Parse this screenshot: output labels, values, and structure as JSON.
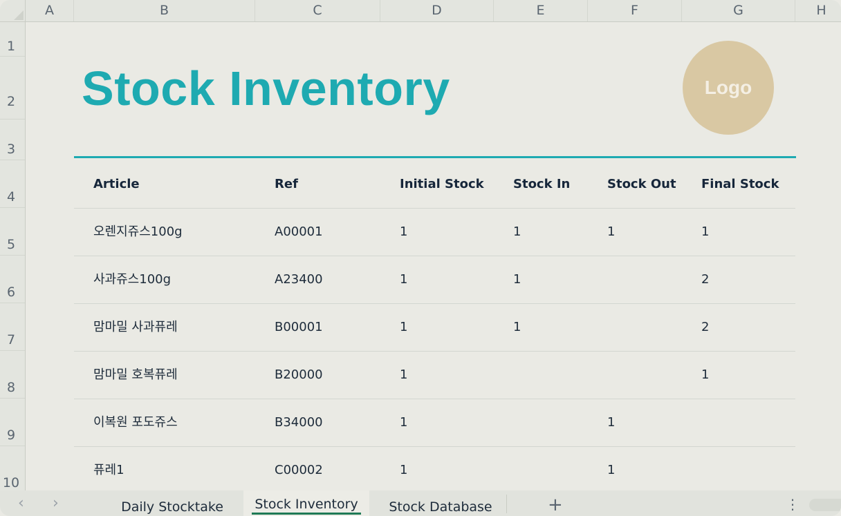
{
  "columns": [
    "A",
    "B",
    "C",
    "D",
    "E",
    "F",
    "G",
    "H"
  ],
  "rows": [
    "1",
    "2",
    "3",
    "4",
    "5",
    "6",
    "7",
    "8",
    "9",
    "10"
  ],
  "sheet": {
    "title": "Stock Inventory",
    "logo_text": "Logo",
    "headers": [
      "Article",
      "Ref",
      "Initial Stock",
      "Stock In",
      "Stock Out",
      "Final Stock"
    ],
    "records": [
      {
        "article": "오렌지쥬스100g",
        "ref": "A00001",
        "initial": "1",
        "in": "1",
        "out": "1",
        "final": "1"
      },
      {
        "article": "사과쥬스100g",
        "ref": "A23400",
        "initial": "1",
        "in": "1",
        "out": "",
        "final": "2"
      },
      {
        "article": "맘마밀 사과퓨레",
        "ref": "B00001",
        "initial": "1",
        "in": "1",
        "out": "",
        "final": "2"
      },
      {
        "article": "맘마밀 호복퓨레",
        "ref": "B20000",
        "initial": "1",
        "in": "",
        "out": "",
        "final": "1"
      },
      {
        "article": "이복원 포도쥬스",
        "ref": "B34000",
        "initial": "1",
        "in": "",
        "out": "1",
        "final": ""
      },
      {
        "article": "퓨레1",
        "ref": "C00002",
        "initial": "1",
        "in": "",
        "out": "1",
        "final": ""
      }
    ]
  },
  "tabs": [
    "Daily Stocktake",
    "Stock Inventory",
    "Stock Database"
  ],
  "active_tab": "Stock Inventory",
  "colors": {
    "accent": "#1eaab1",
    "logo": "#d9c8a3",
    "active_tab_line": "#1f7a56"
  }
}
